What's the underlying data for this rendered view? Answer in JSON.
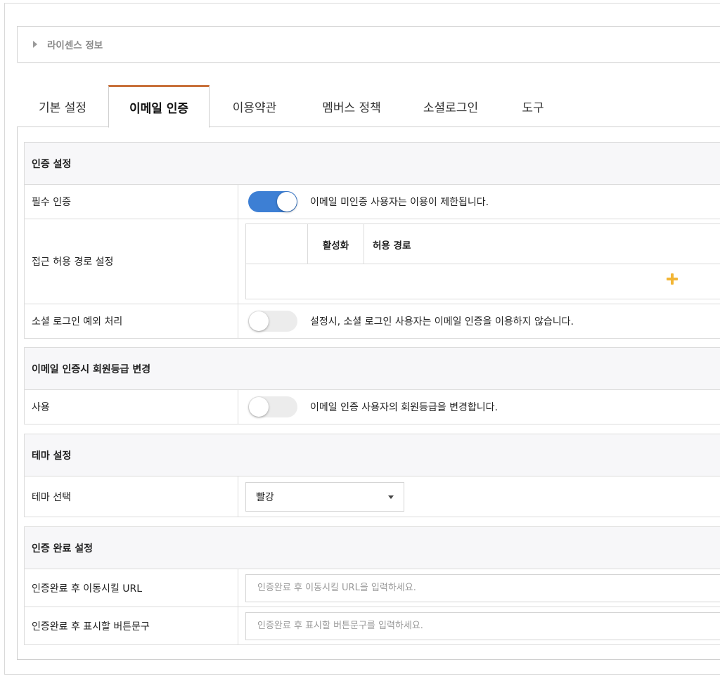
{
  "license": {
    "label": "라이센스 정보"
  },
  "tabs": [
    {
      "label": "기본 설정"
    },
    {
      "label": "이메일 인증"
    },
    {
      "label": "이용약관"
    },
    {
      "label": "멤버스 정책"
    },
    {
      "label": "소셜로그인"
    },
    {
      "label": "도구"
    }
  ],
  "active_tab": "이메일 인증",
  "auth_settings": {
    "title": "인증 설정",
    "required": {
      "label": "필수 인증",
      "enabled": true,
      "desc": "이메일 미인증 사용자는 이용이 제한됩니다."
    },
    "routes": {
      "label": "접근 허용 경로 설정",
      "col_active": "활성화",
      "col_path": "허용 경로",
      "add_icon": "plus-icon"
    },
    "social_exception": {
      "label": "소셜 로그인 예외 처리",
      "enabled": false,
      "desc": "설정시, 소셜 로그인 사용자는 이메일 인증을 이용하지 않습니다."
    }
  },
  "grade_change": {
    "title": "이메일 인증시 회원등급 변경",
    "use": {
      "label": "사용",
      "enabled": false,
      "desc": "이메일 인증 사용자의 회원등급을 변경합니다."
    }
  },
  "theme": {
    "title": "테마 설정",
    "select": {
      "label": "테마 선택",
      "value": "빨강"
    }
  },
  "completion": {
    "title": "인증 완료 설정",
    "url": {
      "label": "인증완료 후 이동시킬 URL",
      "placeholder": "인증완료 후 이동시킬 URL을 입력하세요."
    },
    "button_text": {
      "label": "인증완료 후 표시할 버튼문구",
      "placeholder": "인증완료 후 표시할 버튼문구를 입력하세요."
    }
  },
  "colors": {
    "active_tab_accent": "#c8703a",
    "toggle_on": "#3d7fd4",
    "plus": "#f2b535"
  }
}
